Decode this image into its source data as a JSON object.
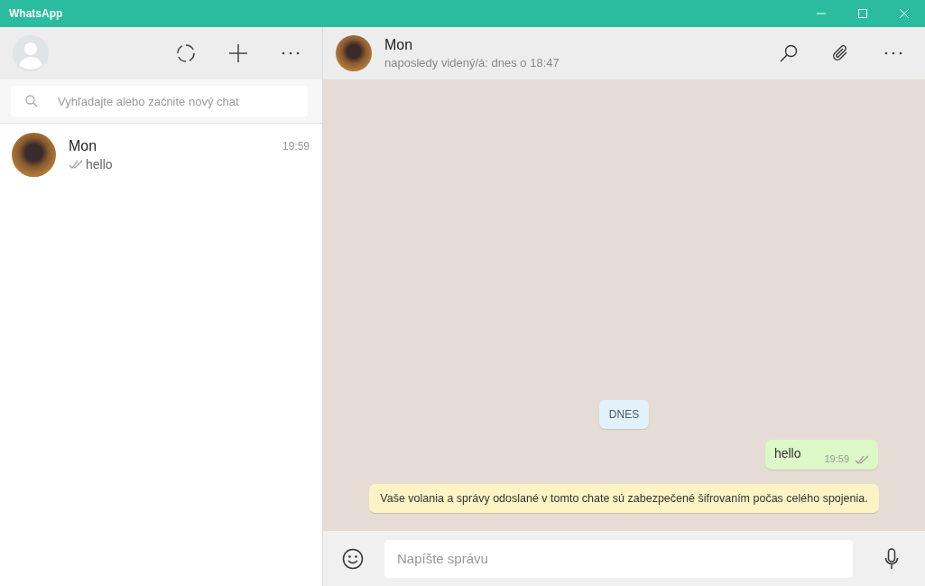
{
  "window": {
    "title": "WhatsApp"
  },
  "sidebar": {
    "search": {
      "placeholder": "Vyhľadajte alebo začnite nový chat"
    },
    "chats": [
      {
        "name": "Mon",
        "time": "19:59",
        "preview": "hello",
        "selected": false
      }
    ]
  },
  "conversation": {
    "name": "Mon",
    "status": "naposledy videný/á: dnes o 18:47",
    "messages": [
      {
        "kind": "date",
        "text": "DNES"
      },
      {
        "kind": "outgoing",
        "text": "hello",
        "time": "19:59"
      },
      {
        "kind": "notice",
        "text": "Vaše volania a správy odoslané v tomto chate sú zabezpečené šifrovaním počas celého spojenia."
      }
    ],
    "composer": {
      "placeholder": "Napíšte správu"
    }
  }
}
